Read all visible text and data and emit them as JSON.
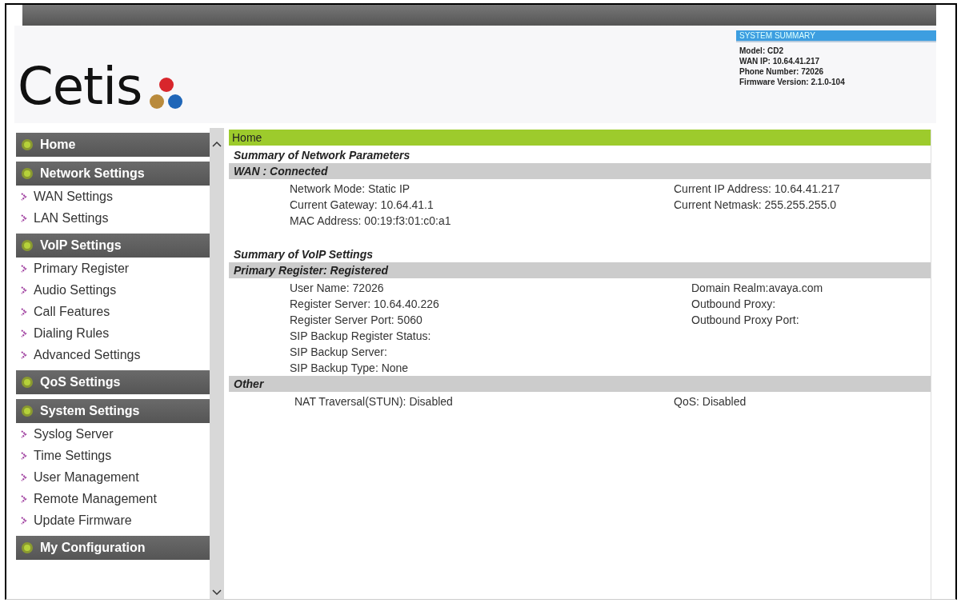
{
  "logo": {
    "text": "Cetis"
  },
  "system_summary": {
    "title": "SYSTEM SUMMARY",
    "lines": [
      "Model: CD2",
      "WAN IP: 10.64.41.217",
      "Phone Number: 72026",
      "Firmware Version: 2.1.0-104"
    ]
  },
  "sidebar": {
    "items": [
      {
        "kind": "header",
        "label": "Home"
      },
      {
        "kind": "header",
        "label": "Network Settings"
      },
      {
        "kind": "link",
        "label": "WAN Settings"
      },
      {
        "kind": "link",
        "label": "LAN Settings"
      },
      {
        "kind": "header",
        "label": "VoIP Settings"
      },
      {
        "kind": "link",
        "label": "Primary Register"
      },
      {
        "kind": "link",
        "label": "Audio Settings"
      },
      {
        "kind": "link",
        "label": "Call Features"
      },
      {
        "kind": "link",
        "label": "Dialing Rules"
      },
      {
        "kind": "link",
        "label": "Advanced Settings"
      },
      {
        "kind": "header",
        "label": "QoS Settings"
      },
      {
        "kind": "header",
        "label": "System Settings"
      },
      {
        "kind": "link",
        "label": "Syslog Server"
      },
      {
        "kind": "link",
        "label": "Time Settings"
      },
      {
        "kind": "link",
        "label": "User Management"
      },
      {
        "kind": "link",
        "label": "Remote Management"
      },
      {
        "kind": "link",
        "label": "Update Firmware"
      },
      {
        "kind": "header",
        "label": "My Configuration"
      }
    ]
  },
  "page_title": "Home",
  "sections": [
    {
      "title": "Summary of Network Parameters",
      "heading": "WAN : Connected",
      "left": [
        "Network Mode: Static IP",
        "Current Gateway: 10.64.41.1",
        "MAC Address: 00:19:f3:01:c0:a1"
      ],
      "right": [
        "Current IP Address: 10.64.41.217",
        "Current Netmask: 255.255.255.0"
      ]
    },
    {
      "title": "Summary of VoIP Settings",
      "heading": "Primary Register: Registered",
      "left": [
        "User Name: 72026",
        "Register Server: 10.64.40.226",
        "Register Server Port: 5060",
        "SIP Backup Register Status:",
        "SIP Backup Server:",
        "SIP Backup Type: None"
      ],
      "right": [
        "Domain Realm:avaya.com",
        "Outbound Proxy:",
        "Outbound Proxy Port:"
      ]
    },
    {
      "heading": "Other",
      "left": [
        "NAT Traversal(STUN): Disabled"
      ],
      "right": [
        "QoS: Disabled"
      ]
    }
  ]
}
